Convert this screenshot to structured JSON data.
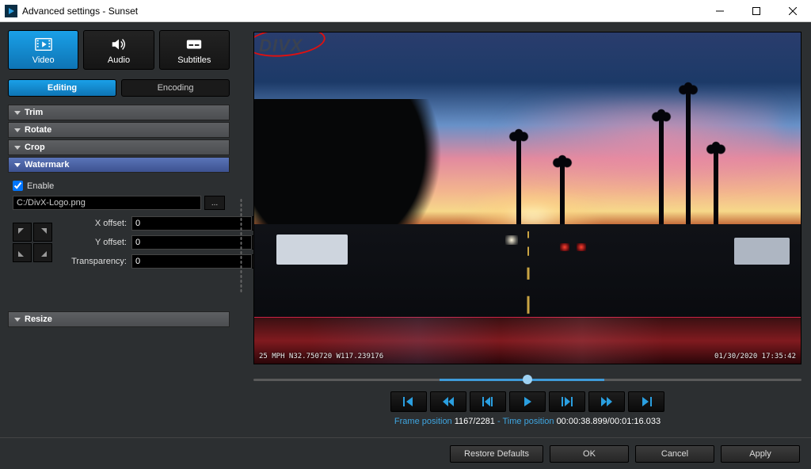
{
  "window": {
    "title": "Advanced settings - Sunset"
  },
  "big_tabs": {
    "video": "Video",
    "audio": "Audio",
    "subtitles": "Subtitles"
  },
  "sub_tabs": {
    "editing": "Editing",
    "encoding": "Encoding"
  },
  "sections": {
    "trim": "Trim",
    "rotate": "Rotate",
    "crop": "Crop",
    "watermark": "Watermark",
    "resize": "Resize"
  },
  "watermark": {
    "enable_label": "Enable",
    "enable_checked": true,
    "path": "C:/DivX-Logo.png",
    "browse": "...",
    "x_offset_label": "X offset:",
    "x_offset": "0",
    "y_offset_label": "Y offset:",
    "y_offset": "0",
    "transparency_label": "Transparency:",
    "transparency": "0"
  },
  "preview": {
    "watermark_text": "DIVX",
    "overlay_bl": "25 MPH N32.750720 W117.239176",
    "overlay_br": "01/30/2020  17:35:42"
  },
  "frame_info": {
    "frame_label": "Frame position ",
    "frame_value": "1167/2281",
    "sep": " - ",
    "time_label": "Time position ",
    "time_value": "00:00:38.899/00:01:16.033"
  },
  "buttons": {
    "restore": "Restore Defaults",
    "ok": "OK",
    "cancel": "Cancel",
    "apply": "Apply"
  }
}
